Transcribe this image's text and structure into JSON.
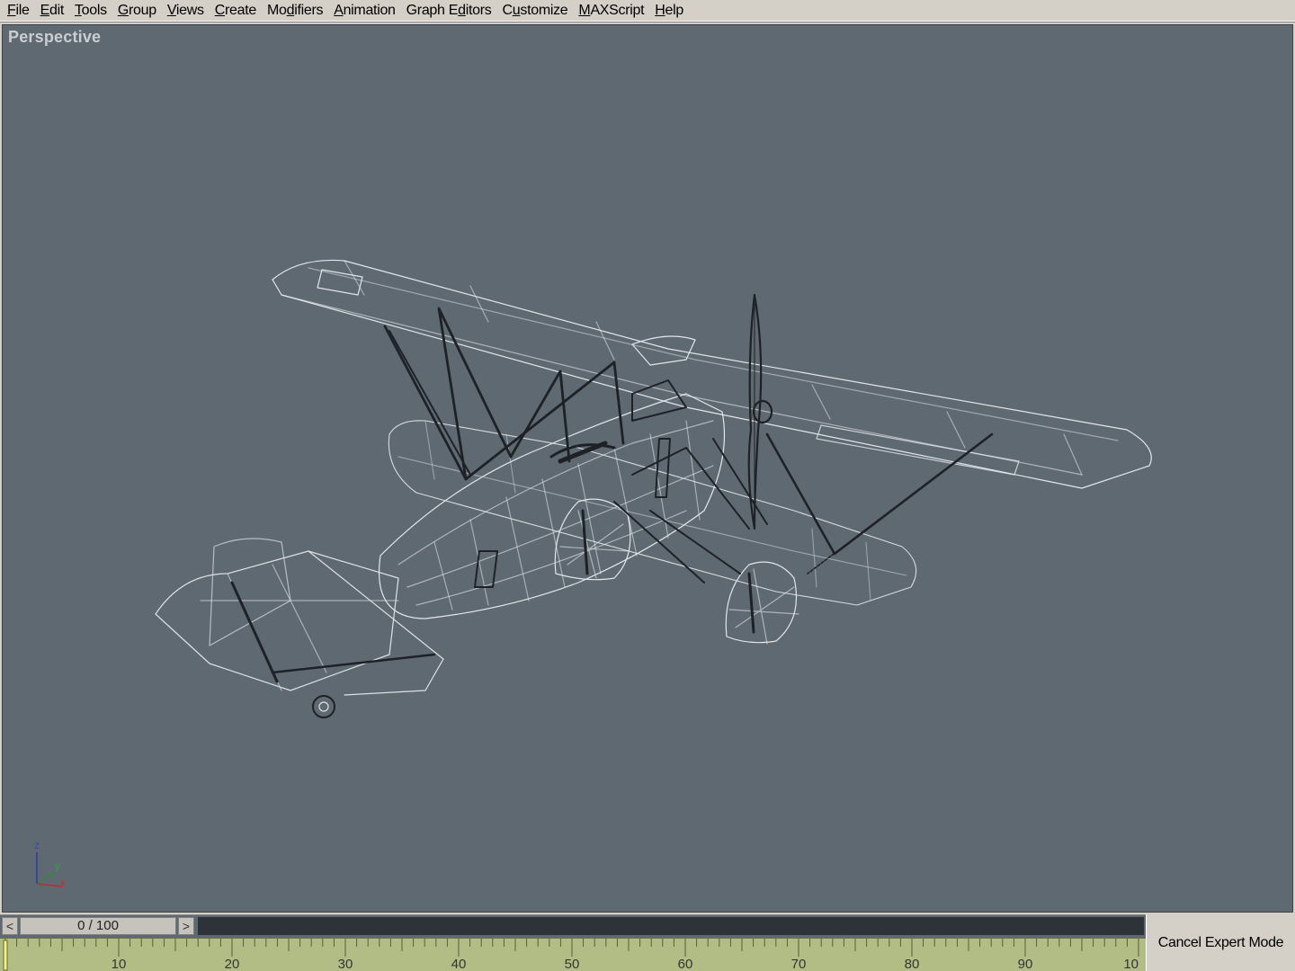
{
  "menu": {
    "items": [
      {
        "pre": "",
        "ul": "F",
        "post": "ile"
      },
      {
        "pre": "",
        "ul": "E",
        "post": "dit"
      },
      {
        "pre": "",
        "ul": "T",
        "post": "ools"
      },
      {
        "pre": "",
        "ul": "G",
        "post": "roup"
      },
      {
        "pre": "",
        "ul": "V",
        "post": "iews"
      },
      {
        "pre": "",
        "ul": "C",
        "post": "reate"
      },
      {
        "pre": "Mo",
        "ul": "d",
        "post": "ifiers"
      },
      {
        "pre": "",
        "ul": "A",
        "post": "nimation"
      },
      {
        "pre": "Graph E",
        "ul": "d",
        "post": "itors"
      },
      {
        "pre": "C",
        "ul": "u",
        "post": "stomize"
      },
      {
        "pre": "",
        "ul": "M",
        "post": "AXScript"
      },
      {
        "pre": "",
        "ul": "H",
        "post": "elp"
      }
    ]
  },
  "viewport": {
    "label": "Perspective",
    "background_color": "#5f6972",
    "axis": {
      "z": "z",
      "y": "y",
      "x": "x"
    }
  },
  "timeslider": {
    "frame_display": "0 / 100",
    "current_frame": 0,
    "total_frames": 100,
    "left_arrow": "<",
    "right_arrow": ">"
  },
  "ruler": {
    "labels": [
      "10",
      "20",
      "30",
      "40",
      "50",
      "60",
      "70",
      "80",
      "90",
      "10"
    ],
    "color": "#b2bd86"
  },
  "expert_mode": {
    "button_label": "Cancel Expert Mode"
  }
}
